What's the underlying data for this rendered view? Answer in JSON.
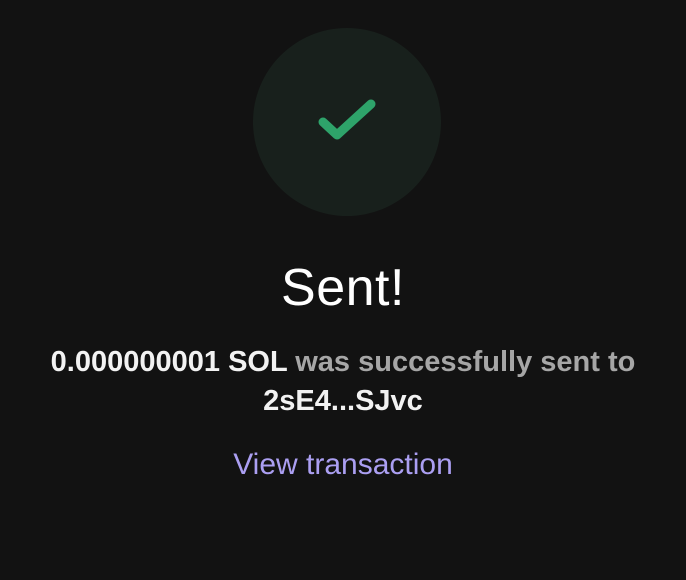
{
  "status_icon": "checkmark-icon",
  "colors": {
    "background": "#121212",
    "icon_circle": "#18201c",
    "check": "#2ea36a",
    "link": "#ab9ff2",
    "muted_text": "#a6a6a6",
    "strong_text": "#f2f2f2"
  },
  "title": "Sent!",
  "message": {
    "amount": "0.000000001 SOL",
    "middle_text": "was successfully sent to",
    "recipient": "2sE4...SJvc"
  },
  "link": {
    "label": "View transaction"
  }
}
